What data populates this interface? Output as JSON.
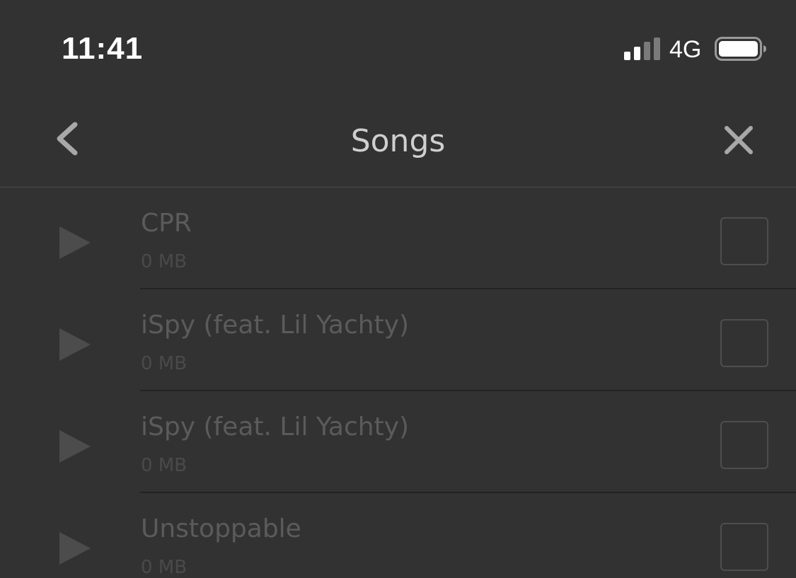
{
  "status_bar": {
    "time": "11:41",
    "network": "4G",
    "signal_icon": "cellular-signal-icon",
    "battery_icon": "battery-icon"
  },
  "nav": {
    "title": "Songs",
    "back_icon": "chevron-left-icon",
    "close_icon": "close-icon"
  },
  "songs": [
    {
      "title": "CPR",
      "size": "0 MB"
    },
    {
      "title": "iSpy (feat. Lil Yachty)",
      "size": "0 MB"
    },
    {
      "title": "iSpy (feat. Lil Yachty)",
      "size": "0 MB"
    },
    {
      "title": "Unstoppable",
      "size": "0 MB"
    }
  ],
  "colors": {
    "background": "#323232",
    "title_text": "#cfcfcf",
    "song_text_disabled": "#5b5b5b",
    "icon_gray": "#7a7a7a"
  }
}
